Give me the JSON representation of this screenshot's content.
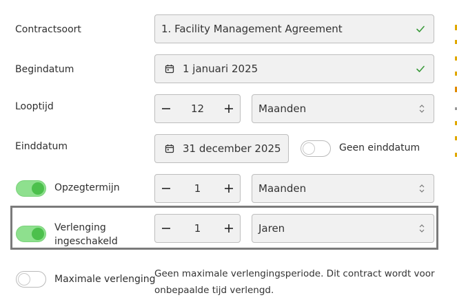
{
  "contract_type": {
    "label": "Contractsoort",
    "value": "1. Facility Management Agreement"
  },
  "start_date": {
    "label": "Begindatum",
    "value": "1 januari 2025"
  },
  "duration": {
    "label": "Looptijd",
    "amount": "12",
    "unit": "Maanden"
  },
  "end_date": {
    "label": "Einddatum",
    "value": "31 december 2025",
    "no_end_label": "Geen einddatum",
    "no_end_enabled": false
  },
  "notice": {
    "label": "Opzegtermijn",
    "enabled": true,
    "amount": "1",
    "unit": "Maanden"
  },
  "renewal": {
    "label": "Verlenging ingeschakeld",
    "enabled": true,
    "amount": "1",
    "unit": "Jaren"
  },
  "max_renewal": {
    "label": "Maximale verlenging",
    "enabled": false,
    "description": "Geen maximale verlengingsperiode. Dit contract wordt voor onbepaalde tijd verlengd."
  },
  "colors": {
    "check": "#3a9a3a",
    "toggle_on": "#8ee08e",
    "toggle_knob_on": "#4cc04c",
    "highlight_border": "#7a7a7a",
    "edge_accent": "#e0a800"
  },
  "icons": {
    "check": "check-icon",
    "calendar": "calendar-icon",
    "minus": "minus-icon",
    "plus": "plus-icon",
    "select_arrows": "chevron-updown-icon"
  }
}
